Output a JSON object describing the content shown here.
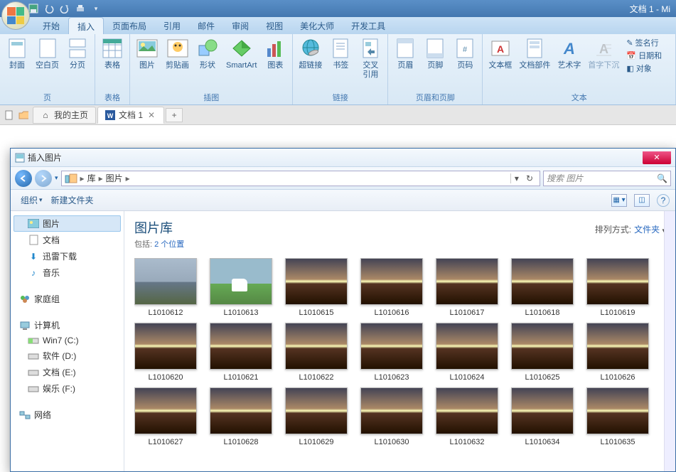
{
  "app": {
    "title": "文档 1 - Mi"
  },
  "ribbon_tabs": [
    "开始",
    "插入",
    "页面布局",
    "引用",
    "邮件",
    "审阅",
    "视图",
    "美化大师",
    "开发工具"
  ],
  "active_ribbon_tab": 1,
  "ribbon_groups": {
    "page": {
      "label": "页",
      "items": [
        "封面",
        "空白页",
        "分页"
      ]
    },
    "table": {
      "label": "表格",
      "items": [
        "表格"
      ]
    },
    "illust": {
      "label": "插图",
      "items": [
        "图片",
        "剪贴画",
        "形状",
        "SmartArt",
        "图表"
      ]
    },
    "link": {
      "label": "链接",
      "items": [
        "超链接",
        "书签",
        "交叉\n引用"
      ]
    },
    "hf": {
      "label": "页眉和页脚",
      "items": [
        "页眉",
        "页脚",
        "页码"
      ]
    },
    "text": {
      "label": "文本",
      "items": [
        "文本框",
        "文档部件",
        "艺术字",
        "首字下沉"
      ]
    },
    "side": [
      "签名行",
      "日期和",
      "对象"
    ]
  },
  "doc_tabs": [
    {
      "label": "我的主页",
      "icon": "home"
    },
    {
      "label": "文档 1",
      "icon": "word",
      "active": true
    }
  ],
  "dialog": {
    "title": "插入图片",
    "breadcrumb": [
      "库",
      "图片"
    ],
    "search_placeholder": "搜索 图片",
    "toolbar": {
      "organize": "组织",
      "newfolder": "新建文件夹"
    },
    "lib_title": "图片库",
    "lib_sub_prefix": "包括: ",
    "lib_sub_link": "2 个位置",
    "sort_label": "排列方式:",
    "sort_value": "文件夹",
    "tree": {
      "libs": [
        {
          "label": "图片",
          "icon": "pics",
          "sel": true
        },
        {
          "label": "文档",
          "icon": "doc"
        },
        {
          "label": "迅雷下载",
          "icon": "dl"
        },
        {
          "label": "音乐",
          "icon": "music"
        }
      ],
      "homegroup": "家庭组",
      "computer": "计算机",
      "drives": [
        "Win7 (C:)",
        "软件 (D:)",
        "文档 (E:)",
        "娱乐 (F:)"
      ],
      "network": "网络"
    },
    "thumbs": [
      [
        "L1010612",
        "L1010613",
        "L1010615",
        "L1010616",
        "L1010617",
        "L1010618",
        "L1010619"
      ],
      [
        "L1010620",
        "L1010621",
        "L1010622",
        "L1010623",
        "L1010624",
        "L1010625",
        "L1010626"
      ],
      [
        "L1010627",
        "L1010628",
        "L1010629",
        "L1010630",
        "L1010632",
        "L1010634",
        "L1010635"
      ]
    ]
  }
}
